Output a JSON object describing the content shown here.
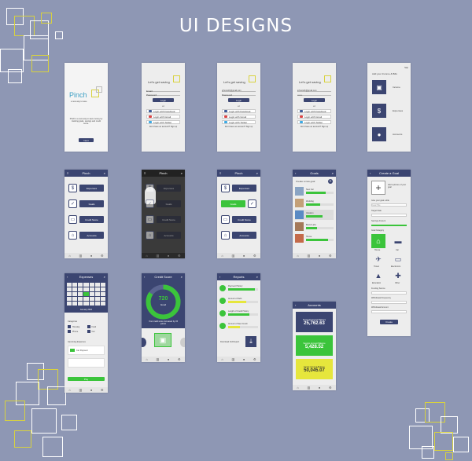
{
  "title": "UI DESIGNS",
  "splash": {
    "brand": "Pinch",
    "tagline": "a new way to save",
    "body": "Pinch is a new way to save money by tracking goals, savings and credit score.",
    "next": "Next"
  },
  "login": {
    "heading": "Let's get saving",
    "email_ph": "Email",
    "email_value": "johnsmith@gmail.com",
    "password_ph": "Password",
    "login": "Login",
    "or": "or",
    "facebook": "Login with Facebook",
    "gmail": "Login with Gmail",
    "twitter": "Login with Twitter",
    "signup": "Don't have an account? Sign up"
  },
  "income": {
    "top": "Skip",
    "heading": "Add your Income & Bills",
    "rows": [
      "Income",
      "Expenses",
      "Accounts"
    ]
  },
  "menu": {
    "title": "Pinch",
    "items": [
      "Expenses",
      "Goals",
      "Credit Score",
      "Accounts"
    ]
  },
  "goals": {
    "title": "Goals",
    "create": "Create a new goal",
    "items": [
      {
        "name": "New Car",
        "pct": 0.7
      },
      {
        "name": "Wedding",
        "pct": 0.5
      },
      {
        "name": "Vacation",
        "pct": 0.6
      },
      {
        "name": "Brand Labs",
        "pct": 0.4
      },
      {
        "name": "House",
        "pct": 0.8
      }
    ]
  },
  "create_goal": {
    "title": "Create a Goal",
    "add_picture": "Add a picture of your goal",
    "goal_title": "Give your goal a title",
    "goal_title_ph": "Goal Title",
    "target_date": "Target Date",
    "savings_amount": "Savings Amount",
    "category": "Goal Category",
    "categories": [
      "House",
      "Car",
      "Travel",
      "Electronics",
      "Education",
      "Other"
    ],
    "funding": "Funding Source",
    "frequency": "Withdrawal Frequency",
    "withdrawal": "Withdrawal Amount",
    "create": "Create"
  },
  "expenses": {
    "title": "Expenses",
    "month": "January 2022",
    "categories": "Categories",
    "cats": [
      "Housing",
      "Food",
      "Phone",
      "Car"
    ],
    "upcoming": "Upcoming Expenses",
    "upcoming_item": "Car Payment",
    "pay": "Pay"
  },
  "credit": {
    "title": "Credit Score",
    "score": "720",
    "rating": "Good",
    "msg": "Your credit score increased by 15 points!"
  },
  "reports": {
    "title": "Reports",
    "items": [
      "Payment History",
      "Amount of Debt",
      "Length of Credit History",
      "Amount of New Credit"
    ],
    "download": "Download Full Report"
  },
  "accounts": {
    "title": "Accounts",
    "cards": [
      {
        "label": "Personal Account Balance",
        "value": "25,762.63",
        "color": "#3b4571"
      },
      {
        "label": "Savings Account Balance",
        "value": "5,428.52",
        "color": "#3bc43b"
      },
      {
        "label": "Family Account Balance",
        "value": "50,045.07",
        "color": "#e6e63c"
      }
    ]
  }
}
